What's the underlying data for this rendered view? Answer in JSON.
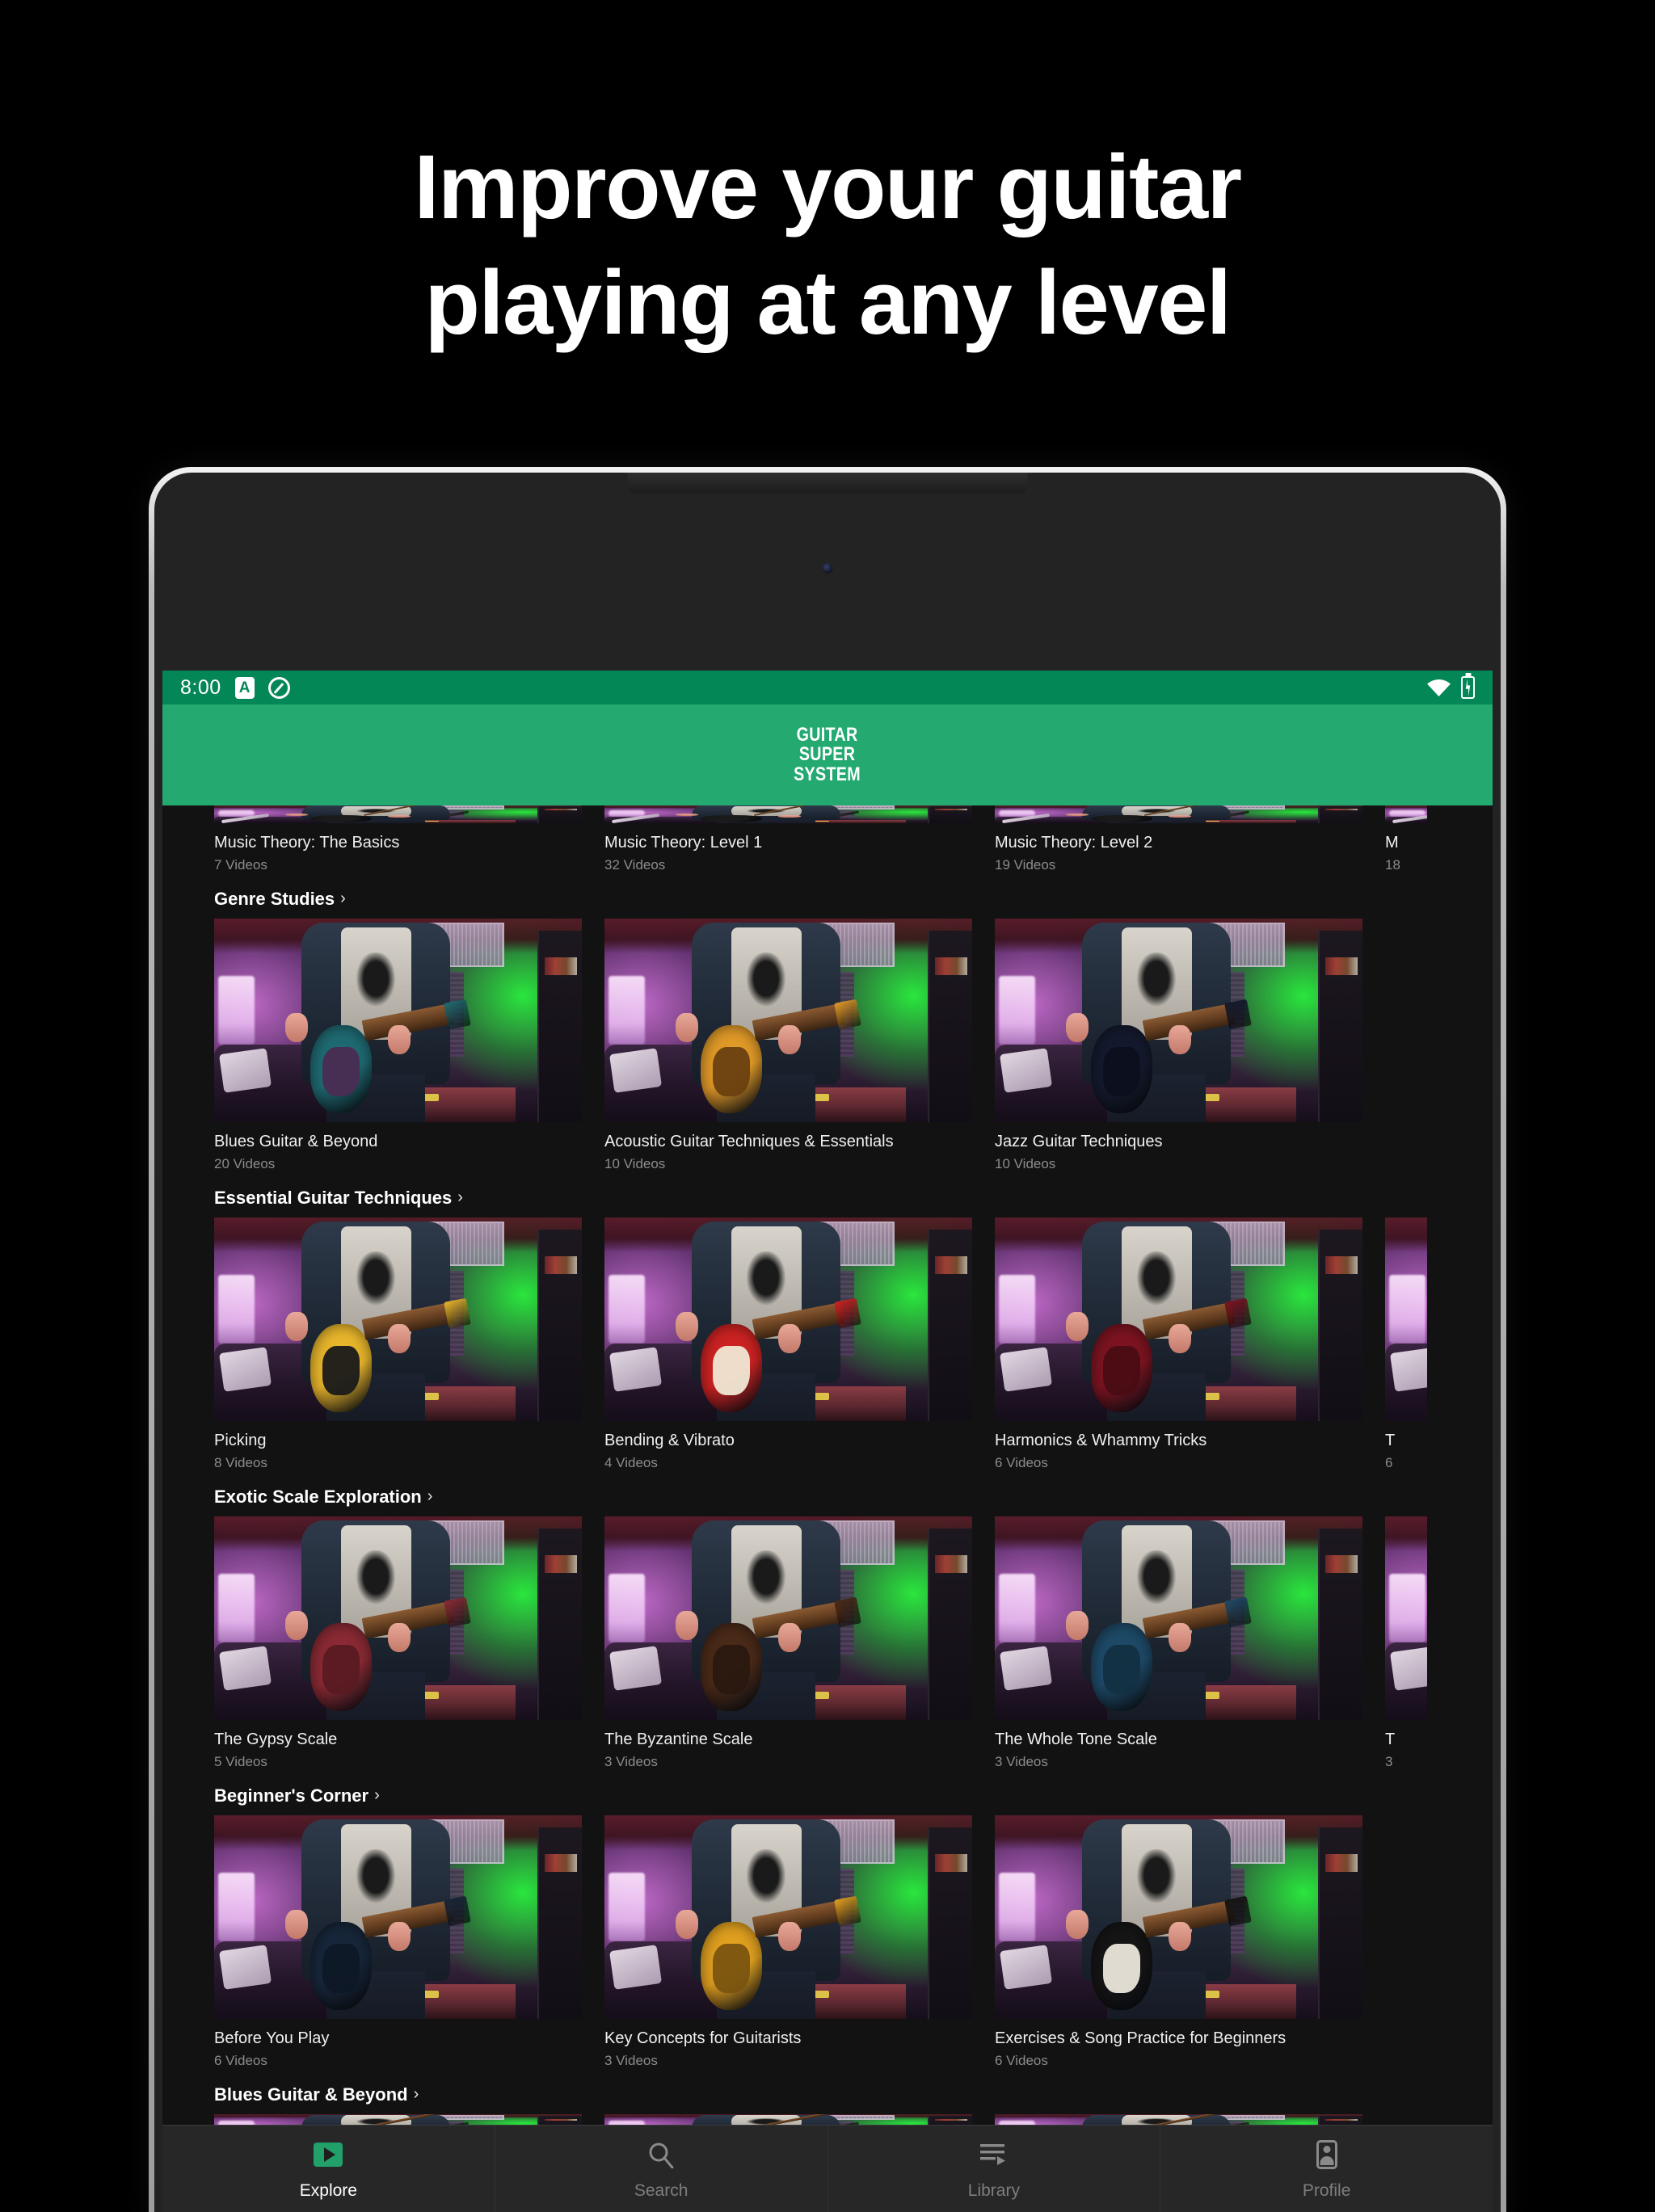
{
  "marketing": {
    "headline_line1": "Improve your guitar",
    "headline_line2": "playing at any level"
  },
  "colors": {
    "status_bar_green": "#048757",
    "app_bar_green": "#24a971",
    "accent_green": "#22a06a",
    "screen_background": "#121212",
    "nav_background": "#272727",
    "primary_text": "#ffffff",
    "secondary_text": "#8c8c8c"
  },
  "status_bar": {
    "time": "8:00",
    "left_icons": [
      "a-badge-icon",
      "do-not-disturb-icon"
    ],
    "right_icons": [
      "wifi-icon",
      "battery-charging-icon"
    ]
  },
  "app_bar": {
    "logo_line1": "GUITAR",
    "logo_line2": "SUPER",
    "logo_line3": "SYSTEM"
  },
  "sections": [
    {
      "title": "",
      "partial": true,
      "cards": [
        {
          "title": "Music Theory: The Basics",
          "videos": "7 Videos"
        },
        {
          "title": "Music Theory: Level 1",
          "videos": "32 Videos"
        },
        {
          "title": "Music Theory: Level 2",
          "videos": "19 Videos"
        },
        {
          "title": "M",
          "videos": "18"
        }
      ]
    },
    {
      "title": "Genre Studies",
      "chevron": "›",
      "cards": [
        {
          "title": "Blues Guitar & Beyond",
          "videos": "20 Videos",
          "guitar_color": "#1f6a72",
          "pickguard_color": "#4a2c52"
        },
        {
          "title": "Acoustic Guitar Techniques & Essentials",
          "videos": "10 Videos",
          "guitar_color": "#e09a28",
          "pickguard_color": "#6a4010"
        },
        {
          "title": "Jazz Guitar Techniques",
          "videos": "10 Videos",
          "guitar_color": "#141a2e",
          "pickguard_color": "#0c101e"
        }
      ]
    },
    {
      "title": "Essential Guitar Techniques",
      "chevron": "›",
      "cards": [
        {
          "title": "Picking",
          "videos": "8 Videos",
          "guitar_color": "#e8b62c",
          "pickguard_color": "#1a1a1a"
        },
        {
          "title": "Bending & Vibrato",
          "videos": "4 Videos",
          "guitar_color": "#cc2222",
          "pickguard_color": "#efe8d4"
        },
        {
          "title": "Harmonics & Whammy Tricks",
          "videos": "6 Videos",
          "guitar_color": "#7c1420",
          "pickguard_color": "#4a0c14"
        },
        {
          "title": "T",
          "videos": "6"
        }
      ]
    },
    {
      "title": "Exotic Scale Exploration",
      "chevron": "›",
      "cards": [
        {
          "title": "The Gypsy Scale",
          "videos": "5 Videos",
          "guitar_color": "#8a2a34",
          "pickguard_color": "#5a1a22"
        },
        {
          "title": "The Byzantine Scale",
          "videos": "3 Videos",
          "guitar_color": "#4a2a18",
          "pickguard_color": "#2a1810"
        },
        {
          "title": "The Whole Tone Scale",
          "videos": "3 Videos",
          "guitar_color": "#1e4a68",
          "pickguard_color": "#123042"
        },
        {
          "title": "T",
          "videos": "3"
        }
      ]
    },
    {
      "title": "Beginner's Corner",
      "chevron": "›",
      "cards": [
        {
          "title": "Before You Play",
          "videos": "6 Videos",
          "guitar_color": "#17263a",
          "pickguard_color": "#0e1826"
        },
        {
          "title": "Key Concepts for Guitarists",
          "videos": "3 Videos",
          "guitar_color": "#e0a020",
          "pickguard_color": "#7a5410"
        },
        {
          "title": "Exercises & Song Practice for Beginners",
          "videos": "6 Videos",
          "guitar_color": "#151515",
          "pickguard_color": "#eae6da"
        }
      ]
    },
    {
      "title": "Blues Guitar & Beyond",
      "chevron": "›",
      "last": true,
      "cards": [
        {
          "title": "",
          "videos": ""
        },
        {
          "title": "",
          "videos": ""
        },
        {
          "title": "",
          "videos": ""
        }
      ]
    }
  ],
  "bottom_nav": [
    {
      "label": "Explore",
      "icon": "explore-play-icon",
      "active": true
    },
    {
      "label": "Search",
      "icon": "search-icon",
      "active": false
    },
    {
      "label": "Library",
      "icon": "library-icon",
      "active": false
    },
    {
      "label": "Profile",
      "icon": "profile-icon",
      "active": false
    }
  ]
}
